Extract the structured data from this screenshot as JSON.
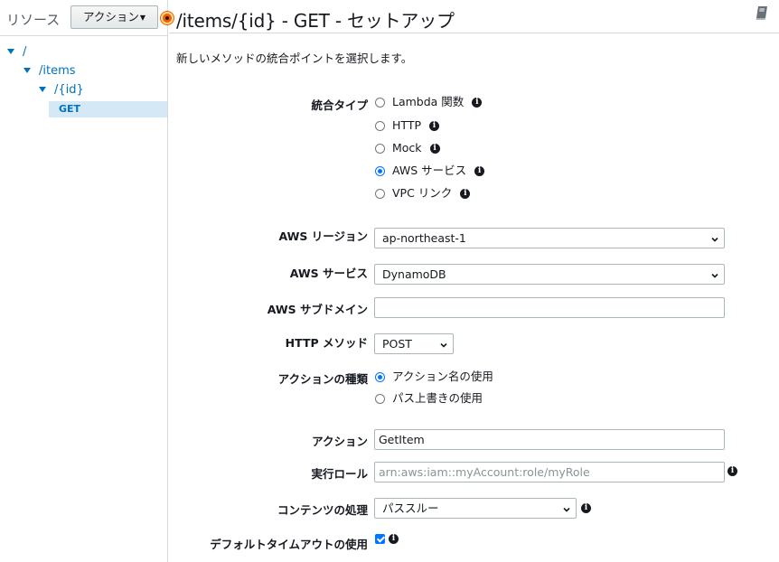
{
  "sidebar": {
    "title": "リソース",
    "actions_button": "アクション",
    "tree": [
      {
        "label": "/"
      },
      {
        "label": "/items"
      },
      {
        "label": "/{id}"
      },
      {
        "label": "GET"
      }
    ]
  },
  "header": {
    "title": "/items/{id} - GET - セットアップ"
  },
  "form": {
    "intro": "新しいメソッドの統合ポイントを選択します。",
    "integration_type": {
      "label": "統合タイプ",
      "options": [
        "Lambda 関数",
        "HTTP",
        "Mock",
        "AWS サービス",
        "VPC リンク"
      ],
      "selected": "AWS サービス"
    },
    "region": {
      "label": "AWS リージョン",
      "value": "ap-northeast-1"
    },
    "service": {
      "label": "AWS サービス",
      "value": "DynamoDB"
    },
    "subdomain": {
      "label": "AWS サブドメイン",
      "value": ""
    },
    "http_method": {
      "label": "HTTP メソッド",
      "value": "POST"
    },
    "action_type": {
      "label": "アクションの種類",
      "options": [
        "アクション名の使用",
        "パス上書きの使用"
      ],
      "selected": "アクション名の使用"
    },
    "action": {
      "label": "アクション",
      "value": "GetItem"
    },
    "execution_role": {
      "label": "実行ロール",
      "value": "",
      "placeholder": "arn:aws:iam::myAccount:role/myRole"
    },
    "content_handling": {
      "label": "コンテンツの処理",
      "value": "パススルー"
    },
    "default_timeout": {
      "label": "デフォルトタイムアウトの使用",
      "checked": true
    }
  },
  "icons": {
    "info": "info-icon",
    "book": "book-icon",
    "chevron": "chevron-down-icon"
  },
  "colors": {
    "link": "#0073bb",
    "selected_row": "#d5e8f5",
    "status": "#eb5f07",
    "control": "#0075ff"
  }
}
